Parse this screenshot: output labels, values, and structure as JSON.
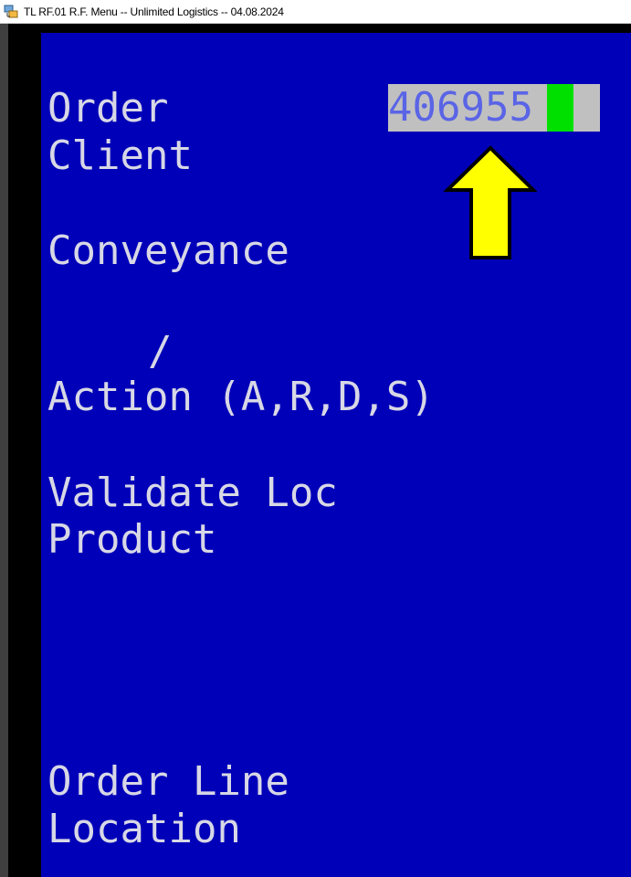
{
  "window": {
    "title": "TL RF.01 R.F. Menu -- Unlimited Logistics -- 04.08.2024",
    "icon": "terminal-app-icon"
  },
  "terminal": {
    "background_color": "#0000b8",
    "text_color": "#d7d7e6",
    "fields": {
      "order_label": "Order",
      "order_value": "406955",
      "client_label": "Client",
      "conveyance_label": "Conveyance",
      "separator": "/",
      "action_label": "Action (A,R,D,S)",
      "validate_loc_label": "Validate Loc",
      "product_label": "Product",
      "order_line_label": "Order Line",
      "location_label": "Location"
    },
    "cursor_color": "#00e000",
    "input_background": "#c0c0c0"
  },
  "annotation": {
    "type": "arrow-up",
    "icon": "up-arrow-icon",
    "color": "#ffff00"
  }
}
